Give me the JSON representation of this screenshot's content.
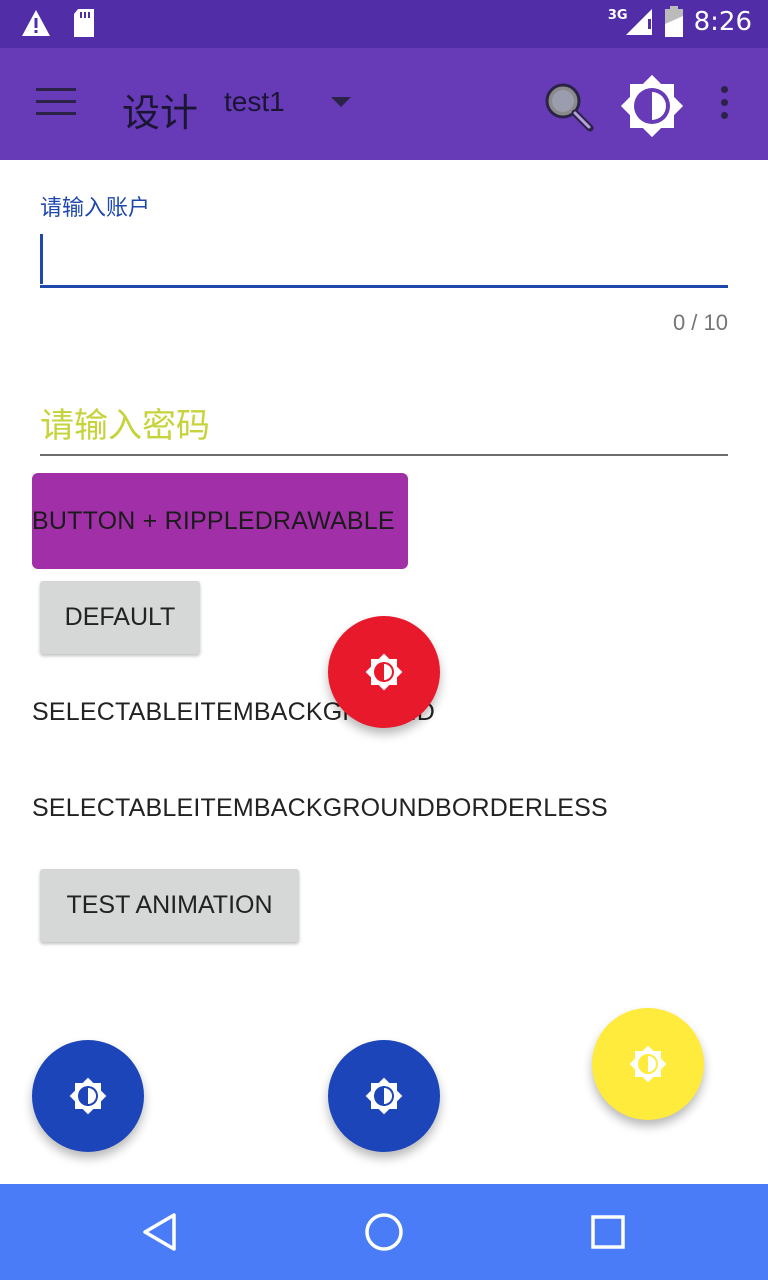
{
  "status_bar": {
    "network": "3G",
    "time": "8:26",
    "icons": [
      "warning-icon",
      "sd-card-icon",
      "signal-icon",
      "battery-icon"
    ]
  },
  "toolbar": {
    "title": "设计",
    "spinner_value": "test1",
    "color": "#673ab7"
  },
  "form": {
    "account_label": "请输入账户",
    "account_value": "",
    "account_counter": "0 / 10",
    "password_placeholder": "请输入密码"
  },
  "buttons": {
    "ripple": "BUTTON + RIPPLEDRAWABLE",
    "default": "DEFAULT",
    "selectable": "SELECTABLEITEMBACKGROUND",
    "selectable_borderless": "SELECTABLEITEMBACKGROUNDBORDERLESS",
    "test_animation": "TEST ANIMATION"
  },
  "fabs": [
    {
      "name": "fab-red",
      "color": "#e8192a",
      "icon": "brightness-icon"
    },
    {
      "name": "fab-blue-left",
      "color": "#1b45b9",
      "icon": "brightness-icon"
    },
    {
      "name": "fab-blue-center",
      "color": "#1b45b9",
      "icon": "brightness-icon"
    },
    {
      "name": "fab-yellow",
      "color": "#ffeb3b",
      "icon": "brightness-icon"
    }
  ],
  "nav_bar": {
    "items": [
      "back-icon",
      "home-icon",
      "recents-icon"
    ],
    "color": "#4a7cf8"
  }
}
